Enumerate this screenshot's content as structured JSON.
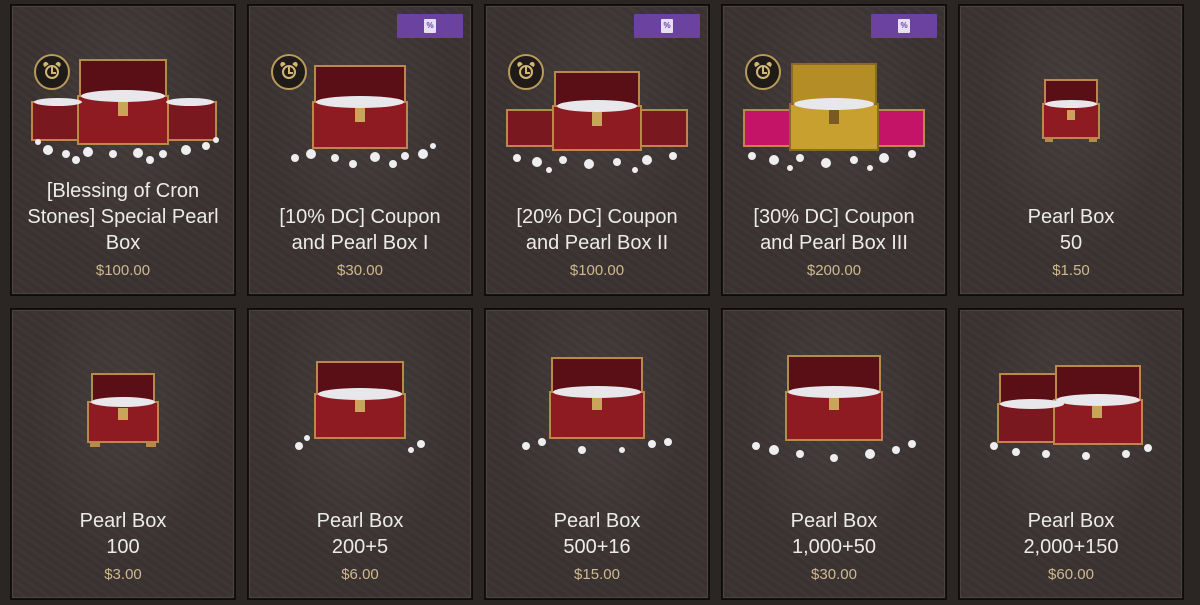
{
  "products": [
    {
      "id": "p1",
      "title": "[Blessing of Cron Stones] Special Pearl Box",
      "title_lines": [
        "[Blessing of Cron",
        "Stones] Special Pearl",
        "Box"
      ],
      "price": "$100.00",
      "badge": false,
      "timer": true,
      "art": "triple-red"
    },
    {
      "id": "p2",
      "title": "[10% DC] Coupon and Pearl Box I",
      "title_lines": [
        "[10% DC] Coupon",
        "and Pearl Box I"
      ],
      "price": "$30.00",
      "badge": true,
      "badge_label": "%",
      "timer": true,
      "art": "single-red"
    },
    {
      "id": "p3",
      "title": "[20% DC] Coupon and Pearl Box II",
      "title_lines": [
        "[20% DC] Coupon",
        "and Pearl Box II"
      ],
      "price": "$100.00",
      "badge": true,
      "badge_label": "%",
      "timer": true,
      "art": "triple-red"
    },
    {
      "id": "p4",
      "title": "[30% DC] Coupon and Pearl Box III",
      "title_lines": [
        "[30% DC] Coupon",
        "and Pearl Box III"
      ],
      "price": "$200.00",
      "badge": true,
      "badge_label": "%",
      "timer": true,
      "art": "triple-gold"
    },
    {
      "id": "p5",
      "title": "Pearl Box 50",
      "title_lines": [
        "Pearl Box",
        "50"
      ],
      "price": "$1.50",
      "badge": false,
      "timer": false,
      "art": "tiny-red"
    },
    {
      "id": "p6",
      "title": "Pearl Box 100",
      "title_lines": [
        "Pearl Box",
        "100"
      ],
      "price": "$3.00",
      "badge": false,
      "timer": false,
      "art": "small-red"
    },
    {
      "id": "p7",
      "title": "Pearl Box 200+5",
      "title_lines": [
        "Pearl Box",
        "200+5"
      ],
      "price": "$6.00",
      "badge": false,
      "timer": false,
      "art": "medium-red"
    },
    {
      "id": "p8",
      "title": "Pearl Box 500+16",
      "title_lines": [
        "Pearl Box",
        "500+16"
      ],
      "price": "$15.00",
      "badge": false,
      "timer": false,
      "art": "medium-red"
    },
    {
      "id": "p9",
      "title": "Pearl Box 1,000+50",
      "title_lines": [
        "Pearl Box",
        "1,000+50"
      ],
      "price": "$30.00",
      "badge": false,
      "timer": false,
      "art": "large-red"
    },
    {
      "id": "p10",
      "title": "Pearl Box 2,000+150",
      "title_lines": [
        "Pearl Box",
        "2,000+150"
      ],
      "price": "$60.00",
      "badge": false,
      "timer": false,
      "art": "double-red"
    }
  ],
  "colors": {
    "background": "#2b2624",
    "card": "#3a3331",
    "title": "#ecebe9",
    "price": "#cfb98e",
    "badge": "#6b42a0",
    "chest_red": "#8e1a22",
    "chest_gold": "#c8a02f",
    "chest_magenta": "#c41467",
    "trim": "#b8894b",
    "pearl": "#f1f1f3"
  }
}
